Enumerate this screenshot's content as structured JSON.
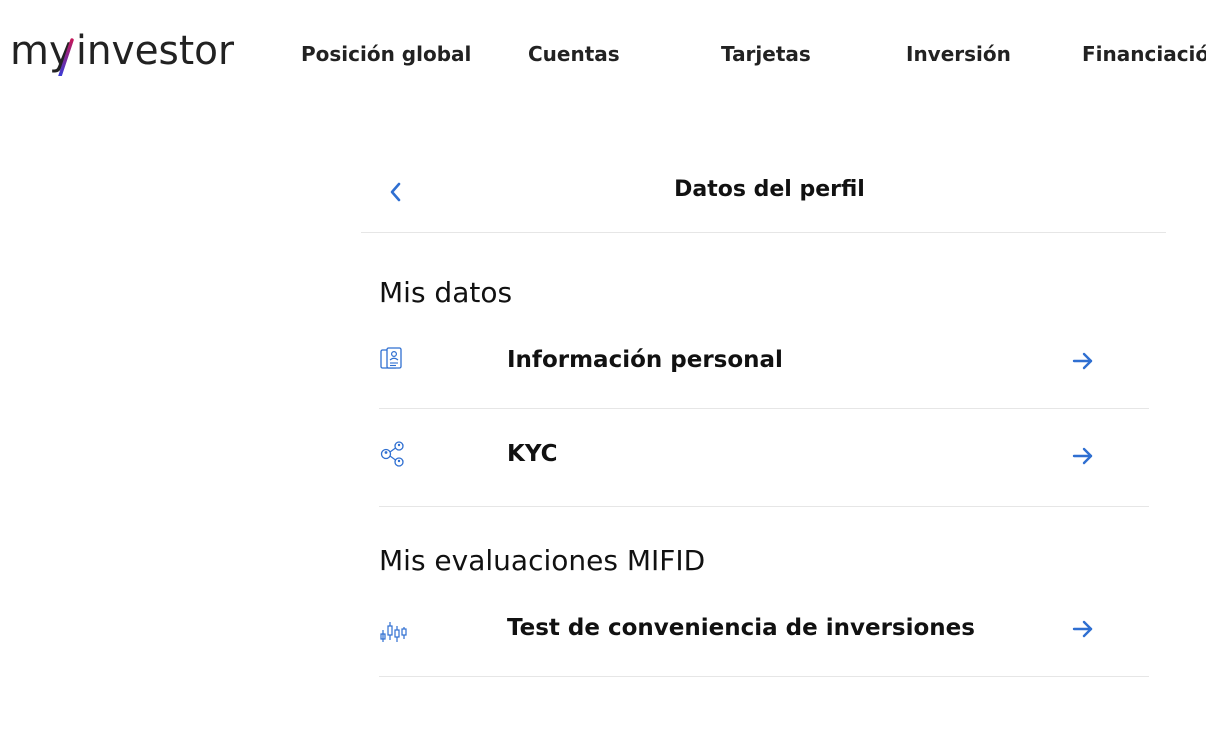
{
  "brand": {
    "logo_text_part1": "my",
    "logo_text_part2": "investor",
    "accent_gradient": [
      "#3a3bd6",
      "#c2185b"
    ],
    "logo_color": "#222222"
  },
  "nav": {
    "items": [
      {
        "label": "Posición global"
      },
      {
        "label": "Cuentas"
      },
      {
        "label": "Tarjetas"
      },
      {
        "label": "Inversión"
      },
      {
        "label": "Financiación"
      }
    ]
  },
  "profile": {
    "title": "Datos del perfil",
    "back_icon": "chevron-left-icon",
    "sections": [
      {
        "title": "Mis datos",
        "items": [
          {
            "label": "Información personal",
            "icon": "id-card-icon"
          },
          {
            "label": "KYC",
            "icon": "people-network-icon"
          }
        ]
      },
      {
        "title": "Mis evaluaciones MIFID",
        "items": [
          {
            "label": "Test de conveniencia de inversiones",
            "icon": "candlestick-icon"
          }
        ]
      }
    ]
  },
  "colors": {
    "accent": "#2f6fd1",
    "divider": "#e6e6e6",
    "text": "#111111"
  }
}
